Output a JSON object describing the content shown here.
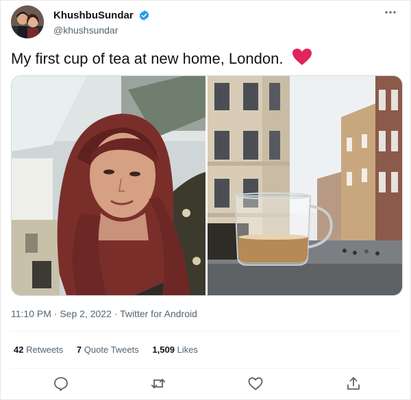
{
  "user": {
    "display_name": "KhushbuSundar",
    "handle": "@khushsundar"
  },
  "tweet": {
    "text": "My first cup of tea at new home, London.",
    "heart": "❤"
  },
  "media": [
    {
      "name": "selfie-photo"
    },
    {
      "name": "tea-cup-street-photo"
    }
  ],
  "meta": {
    "time": "11:10 PM",
    "sep1": " · ",
    "date": "Sep 2, 2022",
    "sep2": " · ",
    "source": "Twitter for Android"
  },
  "stats": {
    "retweets_count": "42",
    "retweets_label": "Retweets",
    "quotes_count": "7",
    "quotes_label": "Quote Tweets",
    "likes_count": "1,509",
    "likes_label": "Likes"
  },
  "icons": {
    "more": "more-options-icon",
    "reply": "reply-icon",
    "retweet": "retweet-icon",
    "like": "like-icon",
    "share": "share-icon"
  },
  "colors": {
    "verified": "#1d9bf0",
    "heart": "#e0245e",
    "secondary_text": "#536471"
  }
}
